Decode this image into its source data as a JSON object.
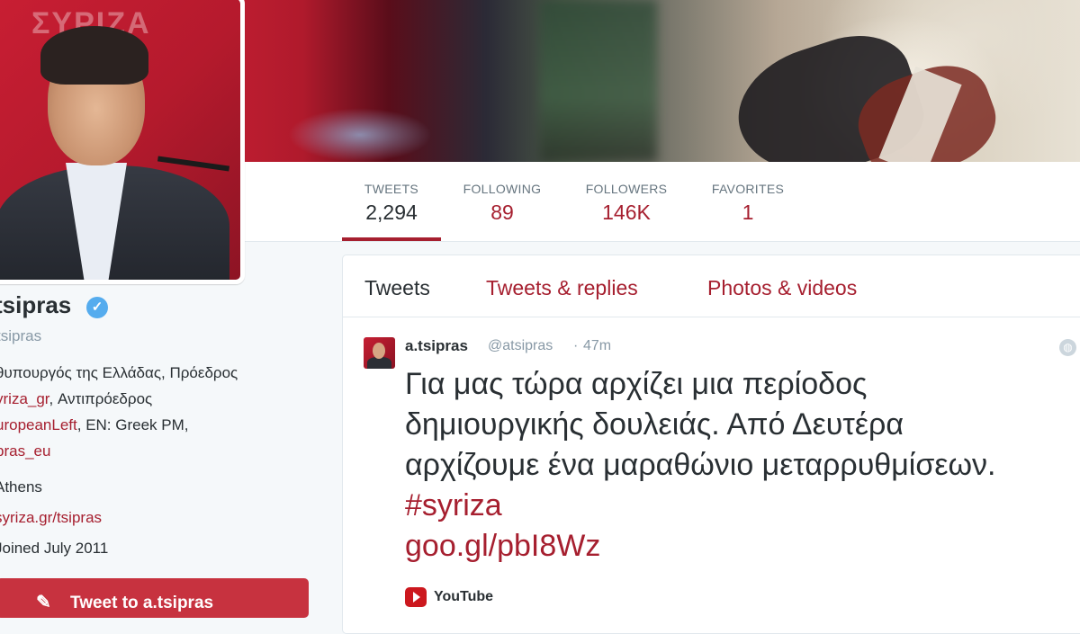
{
  "profile": {
    "full_name": "tsipras",
    "handle": "tsipras",
    "bio_lines": [
      {
        "text": "θυπουργός της Ελλάδας, Πρόεδρος"
      },
      {
        "link": "yriza_gr",
        "text": ", Αντιπρόεδρος"
      },
      {
        "link": "uropeanLeft",
        "text": ", EN: Greek PM,"
      },
      {
        "link": "pras_eu"
      }
    ],
    "location": "Athens",
    "website": "syriza.gr/tsipras",
    "joined": "Joined July 2011",
    "tweet_to_label": "Tweet to a.tsipras",
    "verified_icon": "verified-badge",
    "avatar_banner_text": "ΣΥΡΙΖΑ"
  },
  "stats": {
    "tweets": {
      "label": "TWEETS",
      "value": "2,294"
    },
    "following": {
      "label": "FOLLOWING",
      "value": "89"
    },
    "followers": {
      "label": "FOLLOWERS",
      "value": "146K"
    },
    "favorites": {
      "label": "FAVORITES",
      "value": "1"
    }
  },
  "timeline": {
    "tabs": [
      "Tweets",
      "Tweets & replies",
      "Photos & videos"
    ],
    "active_tab": "Tweets"
  },
  "tweet": {
    "name": "a.tsipras",
    "handle": "@atsipras",
    "separator": "·",
    "time": "47m",
    "text_lines": [
      "Για μας τώρα αρχίζει μια περίοδος",
      "δημιουργικής δουλειάς. Από Δευτέρα",
      "αρχίζουμε ένα μαραθώνιο μεταρρυθμίσεων."
    ],
    "hashtag": "#syriza",
    "url": "goo.gl/pbI8Wz",
    "card_source": "YouTube"
  },
  "colors": {
    "accent": "#a61f2f",
    "button": "#c7323f",
    "verified": "#55acee",
    "muted": "#8899a6"
  }
}
